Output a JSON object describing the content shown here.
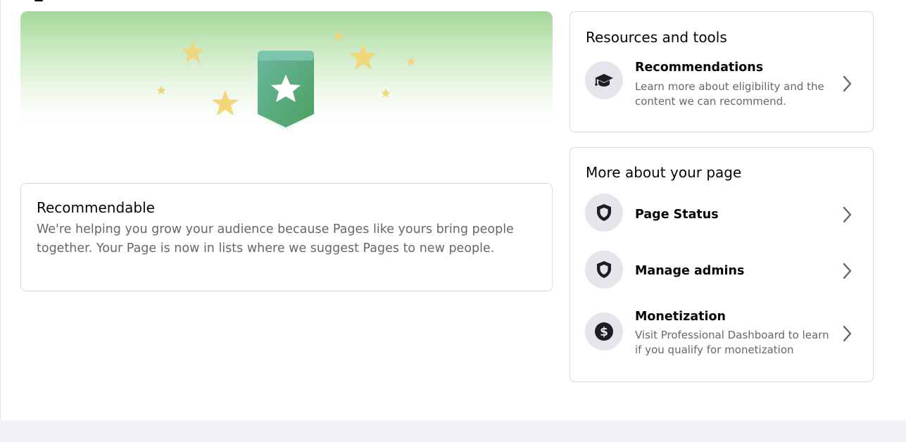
{
  "banner": {
    "icon": "star-badge-icon",
    "colors": {
      "gradient_top": "#a4d89a",
      "badge_top": "#6bb8a0",
      "badge_bottom": "#4aa060",
      "star": "#f1d67a"
    }
  },
  "recommendable": {
    "title": "Recommendable",
    "description": "We're helping you grow your audience because Pages like yours bring people together. Your Page is now in lists where we suggest Pages to new people."
  },
  "resources": {
    "title": "Resources and tools",
    "items": [
      {
        "icon": "graduation-cap-icon",
        "title": "Recommendations",
        "description": "Learn more about eligibility and the content we can recommend."
      }
    ]
  },
  "more_about": {
    "title": "More about your page",
    "items": [
      {
        "icon": "shield-icon",
        "title": "Page Status"
      },
      {
        "icon": "shield-icon",
        "title": "Manage admins"
      },
      {
        "icon": "dollar-circle-icon",
        "title": "Monetization",
        "description": "Visit Professional Dashboard to learn if you qualify for monetization"
      }
    ]
  },
  "colors": {
    "text_primary": "#050505",
    "text_secondary": "#65676b",
    "border": "#d6d9de",
    "icon_bg": "#e4e6eb",
    "page_bg": "#f0f2f5"
  }
}
